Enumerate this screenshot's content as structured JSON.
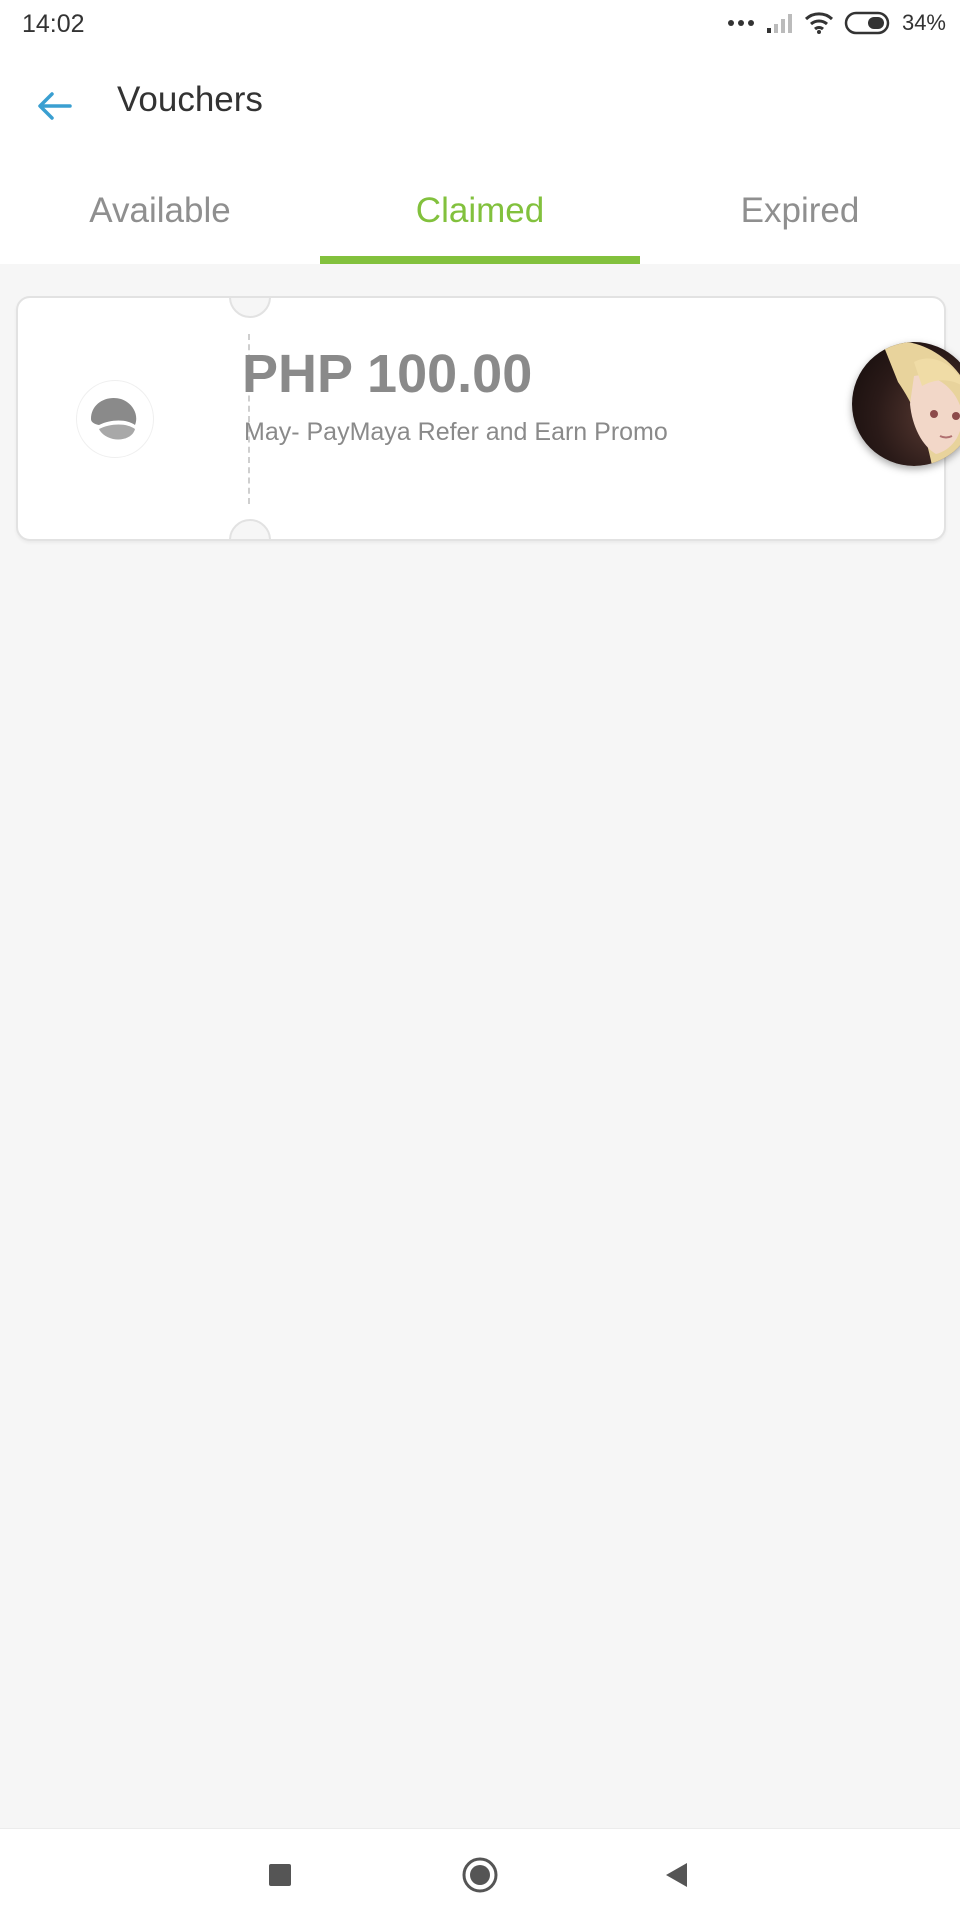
{
  "status_bar": {
    "time": "14:02",
    "battery": "34%",
    "icons": [
      "more-dots-icon",
      "signal-icon",
      "wifi-icon",
      "battery-icon"
    ]
  },
  "header": {
    "back_icon": "arrow-left-icon",
    "title": "Vouchers"
  },
  "tabs": [
    {
      "label": "Available",
      "active": false
    },
    {
      "label": "Claimed",
      "active": true
    },
    {
      "label": "Expired",
      "active": false
    }
  ],
  "vouchers": [
    {
      "icon": "brand-logo-icon",
      "amount": "PHP 100.00",
      "description": "May- PayMaya Refer and Earn Promo"
    }
  ],
  "nav_bar": {
    "icons": [
      "recents-icon",
      "home-icon",
      "back-icon"
    ]
  },
  "colors": {
    "accent": "#82c13d",
    "back_arrow": "#3a9fd1",
    "tab_inactive": "#8f8f8f",
    "background": "#f6f6f6"
  }
}
